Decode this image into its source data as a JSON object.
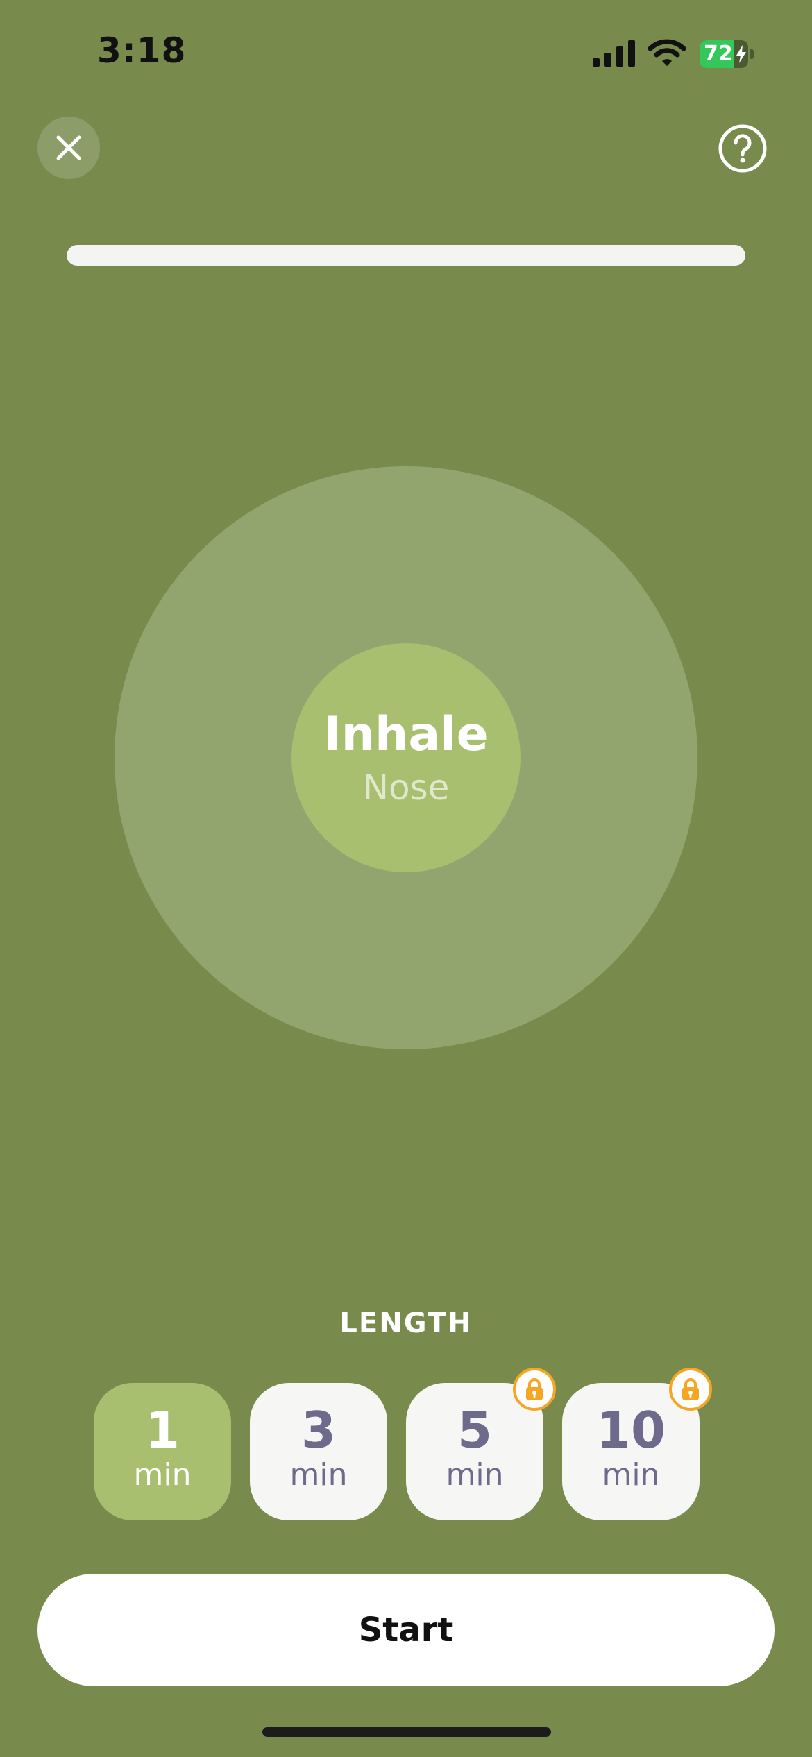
{
  "status_bar": {
    "time": "3:18",
    "battery_percent": "72",
    "battery_level": 0.72,
    "icons": [
      "signal-icon",
      "wifi-icon",
      "battery-icon",
      "charging-bolt-icon"
    ]
  },
  "header": {
    "close_icon": "close-icon",
    "help_icon": "question-mark-icon"
  },
  "progress": {
    "fraction": 1.0
  },
  "breathing": {
    "phase": "Inhale",
    "instruction": "Nose"
  },
  "length": {
    "heading": "LENGTH",
    "options": [
      {
        "value": "1",
        "unit": "min",
        "selected": true,
        "locked": false
      },
      {
        "value": "3",
        "unit": "min",
        "selected": false,
        "locked": false
      },
      {
        "value": "5",
        "unit": "min",
        "selected": false,
        "locked": true
      },
      {
        "value": "10",
        "unit": "min",
        "selected": false,
        "locked": true
      }
    ]
  },
  "start": {
    "label": "Start"
  },
  "colors": {
    "background": "#788b4c",
    "accent_green": "#a7bf6e",
    "outer_circle": "#92a56e",
    "option_text": "#6d6a8c",
    "lock_orange": "#f5a623"
  }
}
